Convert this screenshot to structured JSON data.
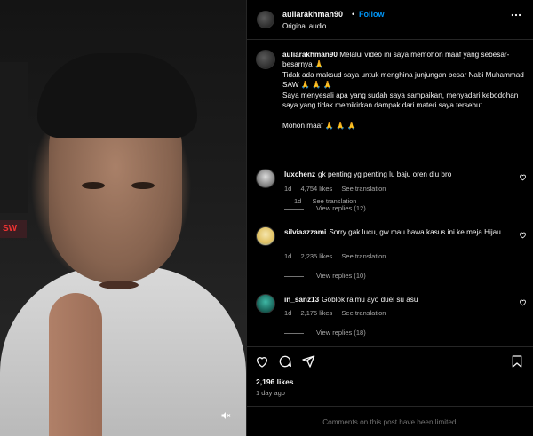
{
  "video": {
    "sign_text": "SW",
    "mute_icon": "speaker-muted-icon"
  },
  "post": {
    "username": "auliarakhman90",
    "dot": "•",
    "follow_label": "Follow",
    "audio": "Original audio",
    "more_icon": "more-options-icon"
  },
  "caption": {
    "username": "auliarakhman90",
    "text": "Melalui video ini saya memohon maaf yang sebesar-besarnya 🙏\nTidak ada maksud saya untuk menghina junjungan besar Nabi Muhammad SAW 🙏 🙏 🙏\nSaya menyesali apa yang sudah saya sampaikan, menyadari kebodohan saya yang tidak memikirkan dampak dari materi saya tersebut.\n\nMohon maaf 🙏 🙏 🙏",
    "time": "1d",
    "see_translation": "See translation"
  },
  "comments": [
    {
      "username": "luxchenz",
      "text": "gk penting yg penting lu baju oren dlu bro",
      "time": "1d",
      "likes": "4,754 likes",
      "see_translation": "See translation",
      "replies": "View replies (12)"
    },
    {
      "username": "silviaazzami",
      "text": "Sorry gak lucu, gw mau bawa kasus ini ke meja Hijau",
      "time": "1d",
      "likes": "2,235 likes",
      "see_translation": "See translation",
      "replies": "View replies (10)"
    },
    {
      "username": "in_sanz13",
      "text": "Goblok raimu ayo duel su asu",
      "time": "1d",
      "likes": "2,175 likes",
      "see_translation": "See translation",
      "replies": "View replies (18)"
    }
  ],
  "actions": {
    "like_icon": "heart-icon",
    "comment_icon": "comment-icon",
    "share_icon": "share-icon",
    "save_icon": "bookmark-icon",
    "likes": "2,196 likes",
    "time_ago": "1 day ago",
    "limited_notice": "Comments on this post have been limited."
  }
}
